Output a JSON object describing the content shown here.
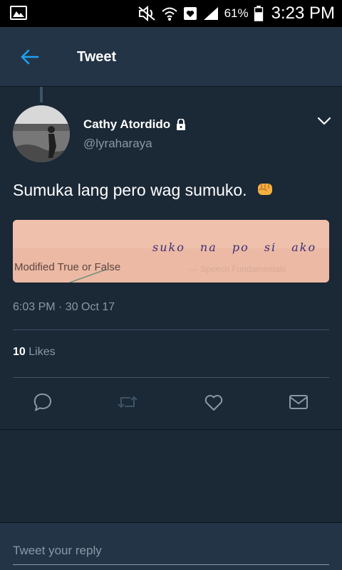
{
  "status_bar": {
    "battery_percent": "61%",
    "time": "3:23 PM",
    "icons": [
      "image-notification-icon",
      "mute-icon",
      "wifi-icon",
      "heart-notification-icon",
      "signal-icon",
      "battery-icon"
    ]
  },
  "header": {
    "title": "Tweet",
    "back_icon": "arrow-left-icon"
  },
  "tweet": {
    "author_name": "Cathy Atordido",
    "author_handle": "@lyraharaya",
    "protected_icon": "lock-icon",
    "text": "Sumuka lang pero wag sumuko.",
    "emoji": "raised-fist-icon",
    "media": {
      "printed_label": "Modified True or False",
      "handwriting": "suko na po si ako"
    },
    "timestamp": "6:03 PM · 30 Oct 17",
    "likes_count": "10",
    "likes_label": "Likes"
  },
  "actions": [
    "reply-icon",
    "retweet-icon",
    "like-icon",
    "direct-message-icon"
  ],
  "reply": {
    "placeholder": "Tweet your reply"
  },
  "colors": {
    "background": "#1b2836",
    "header": "#243447",
    "accent": "#1da1f2",
    "secondary_text": "#8899a6"
  }
}
